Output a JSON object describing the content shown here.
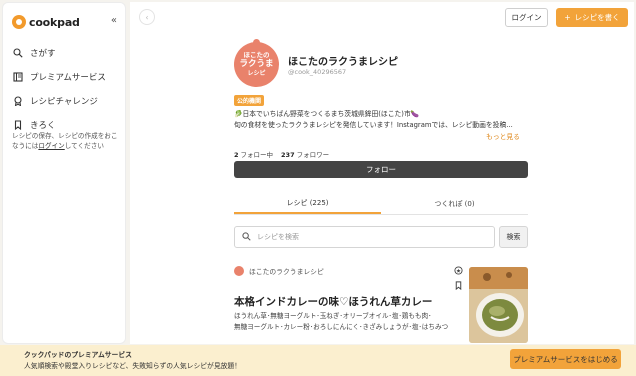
{
  "sidebar": {
    "logo_text": "cookpad",
    "collapse_glyph": "«",
    "items": [
      {
        "label": "さがす",
        "icon": "search-icon"
      },
      {
        "label": "プレミアムサービス",
        "icon": "premium-icon"
      },
      {
        "label": "レシピチャレンジ",
        "icon": "award-icon"
      },
      {
        "label": "きろく",
        "icon": "bookmark-icon"
      }
    ],
    "note_before": "レシピの保存、レシピの作成をおこなうには",
    "note_link": "ログイン",
    "note_after": "してください"
  },
  "header": {
    "back_glyph": "‹",
    "login_label": "ログイン",
    "write_label": "レシピを書く",
    "write_plus": "+"
  },
  "profile": {
    "avatar_line1": "ほこたの",
    "avatar_line2": "ラクうま",
    "avatar_line3": "レシピ",
    "name": "ほこたのラクうまレシピ",
    "handle": "@cook_40296567",
    "badge": "公的機関",
    "bio_line1": "🥬日本でいちばん野菜をつくるまち茨城県鉾田(ほこた)市🍆",
    "bio_line2": "旬の食材を使ったラクうまレシピを発信しています！Instagramでは、レシピ動画を投稿...",
    "more_label": "もっと見る",
    "following_count": "2",
    "following_label": "フォロー中",
    "followers_count": "237",
    "followers_label": "フォロワー",
    "follow_button": "フォロー"
  },
  "tabs": [
    {
      "label": "レシピ (225)",
      "active": true
    },
    {
      "label": "つくれぽ (0)",
      "active": false
    }
  ],
  "search": {
    "placeholder": "レシピを検索",
    "button_label": "検索"
  },
  "recipe_card": {
    "author": "ほこたのラクうまレシピ",
    "title": "本格インドカレーの味♡ほうれん草カレー",
    "ingredients_line1": "ほうれん草･無糖ヨーグルト･玉ねぎ･オリーブオイル･塩･鶏もも肉･",
    "ingredients_line2": "無糖ヨーグルト･カレー粉･おろしにんにく･きざみしょうが･塩･はちみつ"
  },
  "banner": {
    "title": "クックパッドのプレミアムサービス",
    "subtitle": "人気順検索や殿堂入りレシピなど、失敗知らずの人気レシピが見放題！",
    "button_label": "プレミアムサービスをはじめる"
  },
  "colors": {
    "accent": "#f2a33a",
    "avatar": "#e9826b",
    "banner_bg": "#fbefcf",
    "follow_bg": "#444444"
  }
}
